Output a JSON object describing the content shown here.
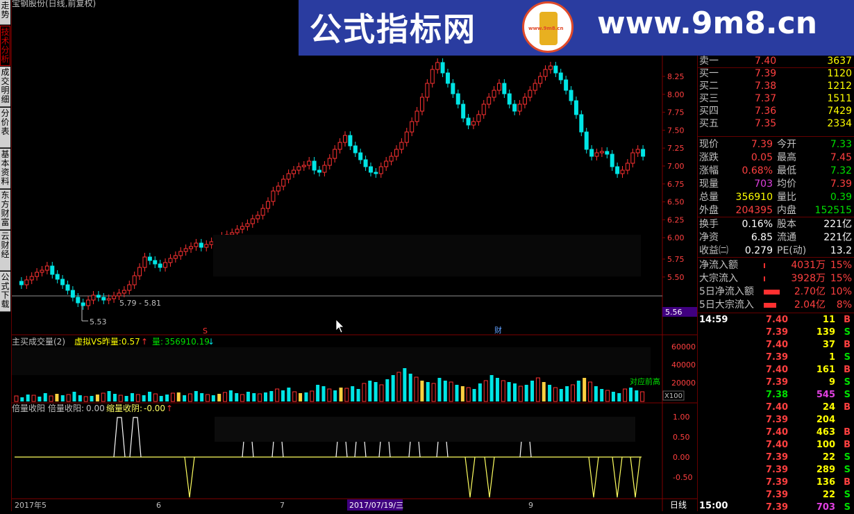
{
  "title": "宝钢股份(日线,前复权)",
  "tabs": [
    "走势",
    "技术分析",
    "成交明细",
    "分价表",
    "基本资料",
    "东方财富",
    "云财经",
    "公式下载"
  ],
  "banner": {
    "site_name": "公式指标网",
    "url": "www.9m8.cn",
    "logo_text": "www.9m8.cn"
  },
  "price_axis": [
    "8.25",
    "8.00",
    "7.75",
    "7.50",
    "7.25",
    "7.00",
    "6.75",
    "6.50",
    "6.25",
    "6.00",
    "5.75",
    "5.50"
  ],
  "price_tag": "5.56",
  "annotations": {
    "low": "5.53",
    "range": "5.79 - 5.81",
    "marker_s": "S",
    "marker_cai": "财"
  },
  "volume_indicator": {
    "name": "主买成交量(2)",
    "ratio_label": "虚拟VS昨量:",
    "ratio_value": "0.57",
    "vol_label": "量:",
    "vol_value": "356910.19",
    "note": "对应前高",
    "axis": [
      "60000",
      "40000",
      "20000"
    ],
    "unit": "X100"
  },
  "osc_indicator": {
    "name": "倍量收阳",
    "item1_label": "倍量收阳:",
    "item1_value": "0.00",
    "item2_label": "缩量收阴:",
    "item2_value": "-0.00",
    "axis": [
      "1.00",
      "0.50",
      "0.00",
      "-0.50"
    ]
  },
  "time_axis": {
    "labels": [
      "2017年5",
      "6",
      "7",
      "9"
    ],
    "cursor_date": "2017/07/19/三",
    "period": "日线"
  },
  "order_book": [
    {
      "label": "卖一",
      "price": "7.40",
      "vol": "3637"
    },
    {
      "label": "买一",
      "price": "7.39",
      "vol": "1120"
    },
    {
      "label": "买二",
      "price": "7.38",
      "vol": "1212"
    },
    {
      "label": "买三",
      "price": "7.37",
      "vol": "1511"
    },
    {
      "label": "买四",
      "price": "7.36",
      "vol": "7429"
    },
    {
      "label": "买五",
      "price": "7.35",
      "vol": "2334"
    }
  ],
  "quote": {
    "now_label": "现价",
    "now": "7.39",
    "open_label": "今开",
    "open": "7.33",
    "chg_label": "涨跌",
    "chg": "0.05",
    "high_label": "最高",
    "high": "7.45",
    "pct_label": "涨幅",
    "pct": "0.68%",
    "low_label": "最低",
    "low": "7.32",
    "cur_label": "现量",
    "cur": "703",
    "avg_label": "均价",
    "avg": "7.39",
    "tot_label": "总量",
    "tot": "356910",
    "vr_label": "量比",
    "vr": "0.39",
    "out_label": "外盘",
    "out": "204395",
    "in_label": "内盘",
    "in": "152515",
    "turn_label": "换手",
    "turn": "0.16%",
    "cap_label": "股本",
    "cap": "221亿",
    "nav_label": "净资",
    "nav": "6.85",
    "float_label": "流通",
    "float": "221亿",
    "eps_label": "收益㈡",
    "eps": "0.279",
    "pe_label": "PE(动)",
    "pe": "13.2"
  },
  "flows": [
    {
      "label": "净流入额",
      "value": "4031万",
      "pct": "15%",
      "bar": 0.03
    },
    {
      "label": "大宗流入",
      "value": "3928万",
      "pct": "15%",
      "bar": 0.03
    },
    {
      "label": "5日净流入额",
      "value": "2.70亿",
      "pct": "10%",
      "bar": 0.9
    },
    {
      "label": "5日大宗流入",
      "value": "2.04亿",
      "pct": "8%",
      "bar": 0.7
    }
  ],
  "ticks_start": "14:59",
  "ticks_end": "15:00",
  "ticks": [
    {
      "price": "7.40",
      "vol": "11",
      "side": "B"
    },
    {
      "price": "7.39",
      "vol": "139",
      "side": "S"
    },
    {
      "price": "7.40",
      "vol": "37",
      "side": "B"
    },
    {
      "price": "7.39",
      "vol": "1",
      "side": "S"
    },
    {
      "price": "7.40",
      "vol": "161",
      "side": "B"
    },
    {
      "price": "7.39",
      "vol": "9",
      "side": "S"
    },
    {
      "price": "7.38",
      "vol": "545",
      "side": "S"
    },
    {
      "price": "7.40",
      "vol": "24",
      "side": "B"
    },
    {
      "price": "7.39",
      "vol": "204",
      "side": ""
    },
    {
      "price": "7.40",
      "vol": "463",
      "side": "B"
    },
    {
      "price": "7.40",
      "vol": "100",
      "side": "B"
    },
    {
      "price": "7.39",
      "vol": "22",
      "side": "S"
    },
    {
      "price": "7.39",
      "vol": "289",
      "side": "S"
    },
    {
      "price": "7.39",
      "vol": "136",
      "side": "B"
    },
    {
      "price": "7.39",
      "vol": "22",
      "side": "S"
    },
    {
      "price": "7.39",
      "vol": "703",
      "side": "S"
    }
  ],
  "colors": {
    "up": "#ff3232",
    "down": "#00e5e5",
    "axis": "#800000",
    "osc": "#ffff60"
  }
}
